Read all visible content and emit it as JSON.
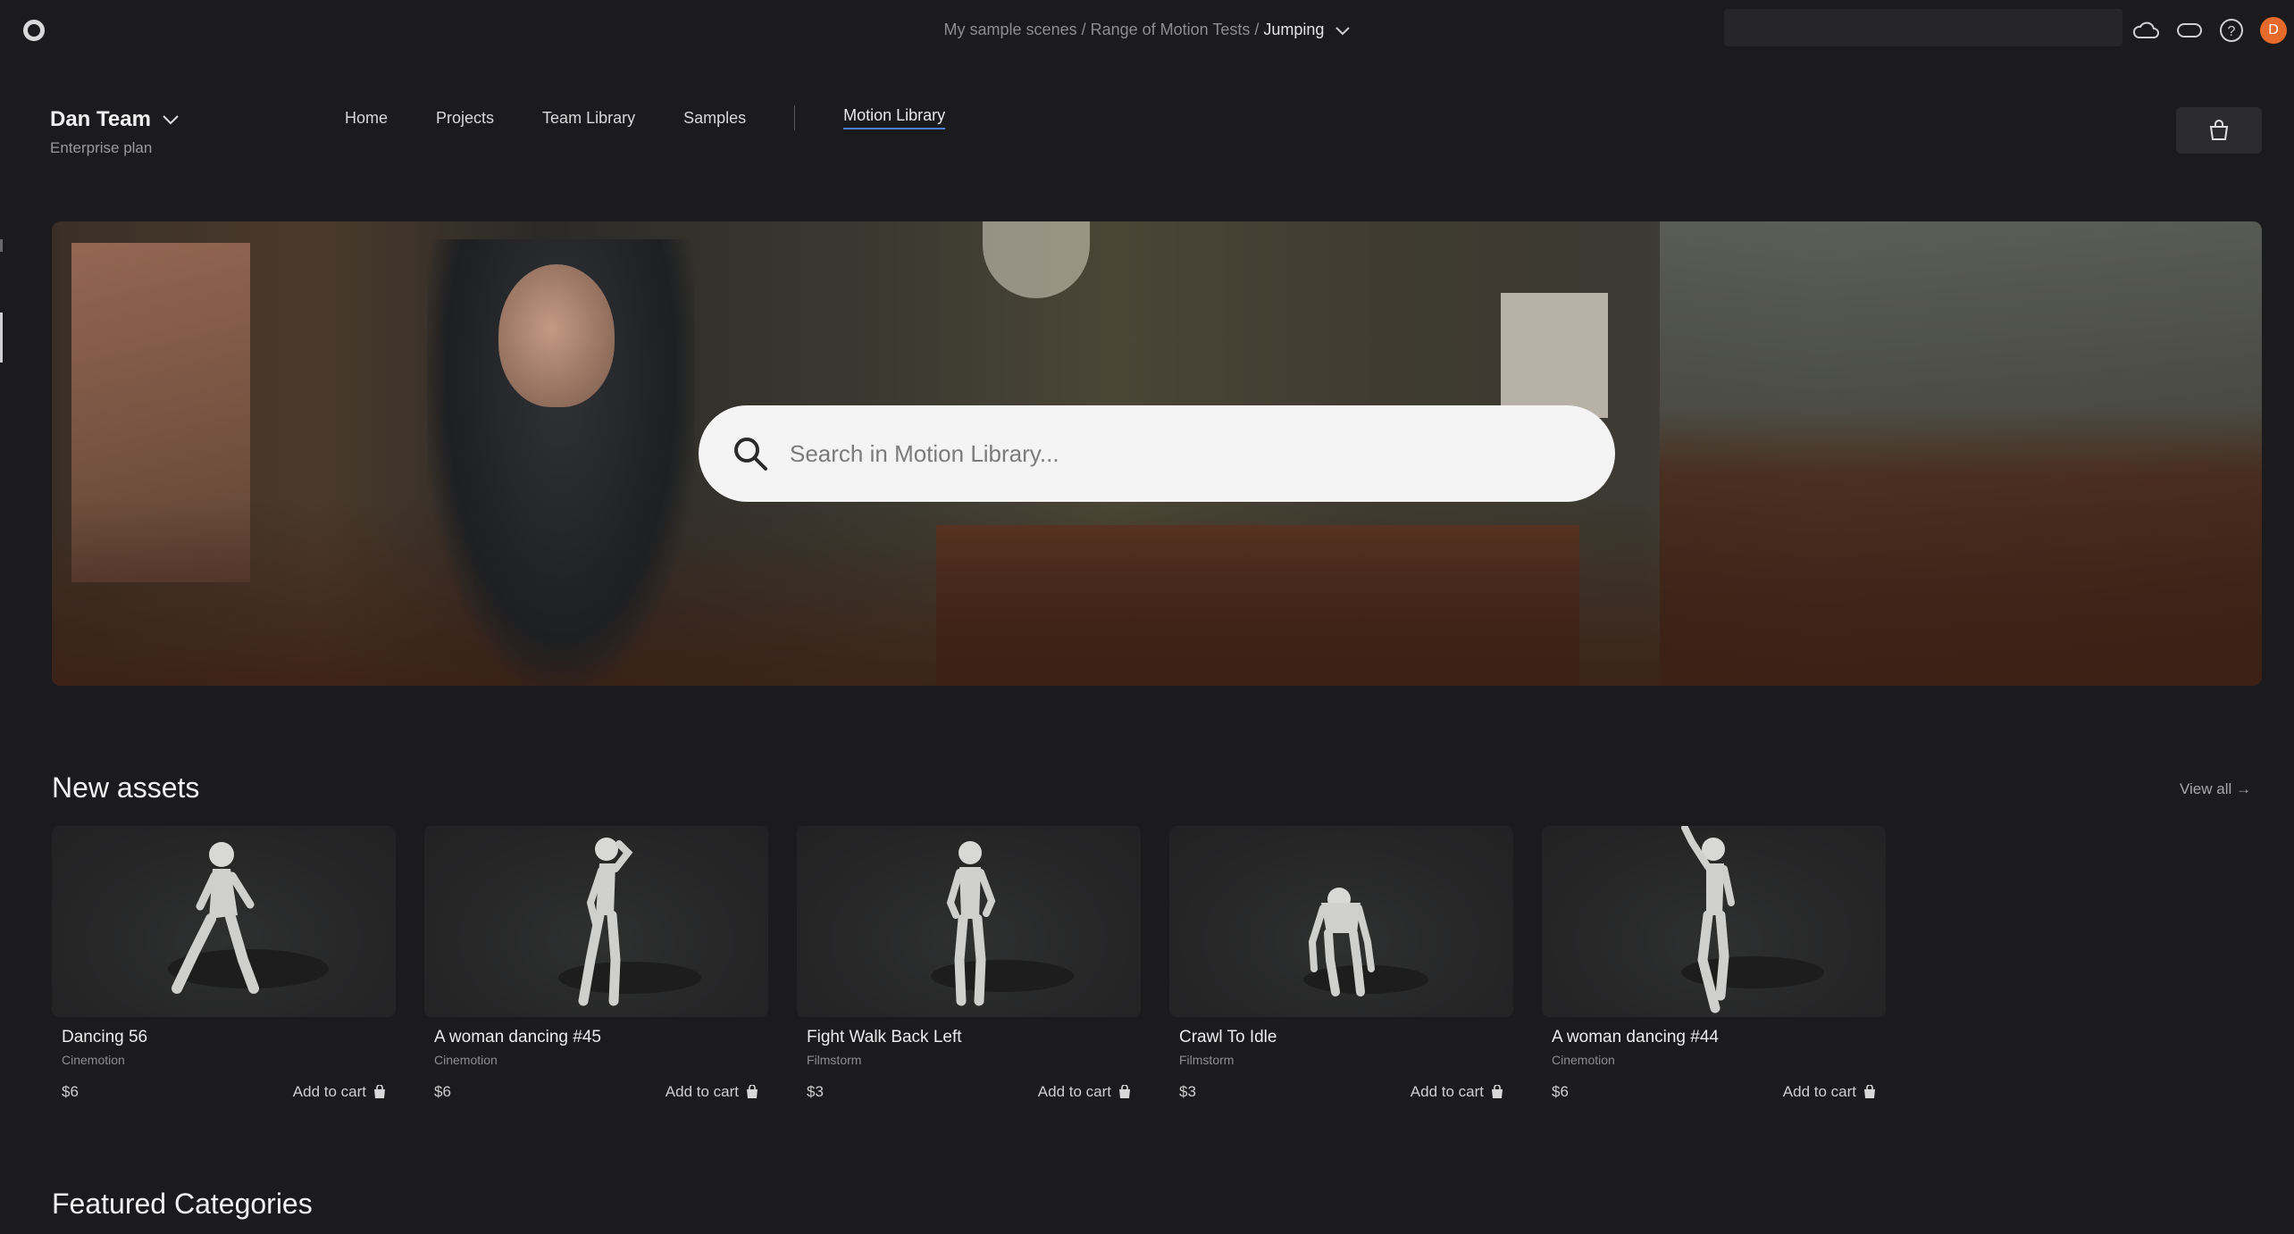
{
  "breadcrumb": {
    "part1": "My sample scenes",
    "sep": " / ",
    "part2": "Range of Motion Tests",
    "current": "Jumping"
  },
  "user": {
    "initial": "D",
    "avatar_color": "#e56a2b"
  },
  "team": {
    "name": "Dan Team",
    "plan": "Enterprise plan"
  },
  "nav": {
    "home": "Home",
    "projects": "Projects",
    "team_library": "Team Library",
    "samples": "Samples",
    "motion_library": "Motion Library"
  },
  "hero": {
    "search_placeholder": "Search in Motion Library..."
  },
  "new_assets": {
    "title": "New assets",
    "view_all": "View all →",
    "items": [
      {
        "title": "Dancing 56",
        "vendor": "Cinemotion",
        "price": "$6",
        "cta": "Add to cart"
      },
      {
        "title": "A woman dancing #45",
        "vendor": "Cinemotion",
        "price": "$6",
        "cta": "Add to cart"
      },
      {
        "title": "Fight Walk Back Left",
        "vendor": "Filmstorm",
        "price": "$3",
        "cta": "Add to cart"
      },
      {
        "title": "Crawl To Idle",
        "vendor": "Filmstorm",
        "price": "$3",
        "cta": "Add to cart"
      },
      {
        "title": "A woman dancing #44",
        "vendor": "Cinemotion",
        "price": "$6",
        "cta": "Add to cart"
      }
    ]
  },
  "featured": {
    "title": "Featured Categories"
  },
  "colors": {
    "background": "#1b1b1d",
    "accent": "#4d7ee0",
    "card": "#262627"
  }
}
